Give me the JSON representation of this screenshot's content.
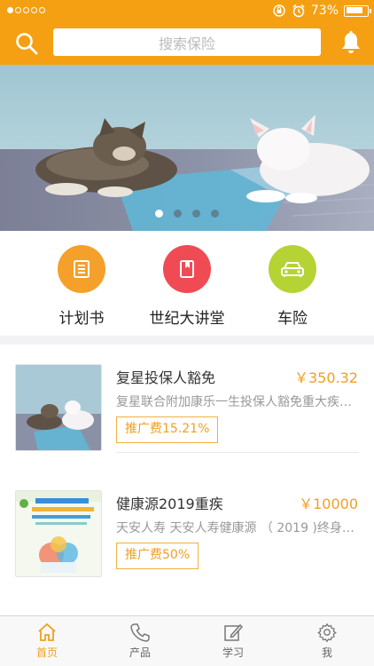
{
  "status_bar": {
    "battery": "73%"
  },
  "header": {
    "search_placeholder": "搜索保险"
  },
  "quick_nav": [
    {
      "label": "计划书",
      "icon": "document-list-icon",
      "color": "#f5a02a"
    },
    {
      "label": "世纪大讲堂",
      "icon": "book-icon",
      "color": "#f04a55"
    },
    {
      "label": "车险",
      "icon": "car-icon",
      "color": "#b5d335"
    }
  ],
  "products": [
    {
      "title": "复星投保人豁免",
      "price": "￥350.32",
      "desc": "复星联合附加康乐一生投保人豁免重大疾病...",
      "badge": "推广费15.21%",
      "thumb": "cats-photo"
    },
    {
      "title": "健康源2019重疾",
      "price": "￥10000",
      "desc": "天安人寿 天安人寿健康源 （ 2019 )终身重...",
      "badge": "推广费50%",
      "thumb": "insurance-poster"
    }
  ],
  "tabs": [
    {
      "label": "首页",
      "icon": "home-icon",
      "active": true
    },
    {
      "label": "产品",
      "icon": "phone-icon",
      "active": false
    },
    {
      "label": "学习",
      "icon": "edit-icon",
      "active": false
    },
    {
      "label": "我",
      "icon": "gear-icon",
      "active": false
    }
  ],
  "colors": {
    "accent": "#f5a012",
    "price": "#f0a020"
  }
}
